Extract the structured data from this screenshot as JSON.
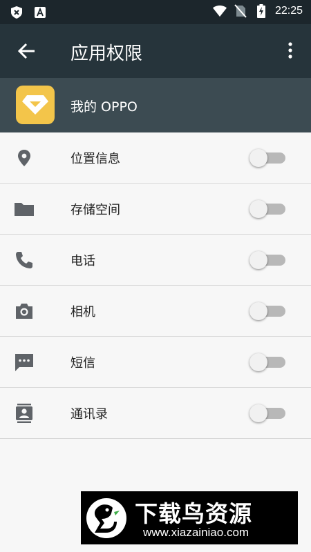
{
  "status_bar": {
    "time": "22:25",
    "left_icons": [
      "shield-x-icon",
      "a-box-icon"
    ],
    "right_icons": [
      "wifi-icon",
      "no-sim-icon",
      "battery-charging-icon"
    ]
  },
  "app_bar": {
    "title": "应用权限",
    "back_icon": "arrow-left-icon",
    "more_icon": "more-vert-icon",
    "background": "#26343b"
  },
  "app_header": {
    "name": "我的 OPPO",
    "icon": "oppo-diamond-icon",
    "icon_color": "#f3c54a",
    "background": "#3c4b52"
  },
  "permissions": [
    {
      "label": "位置信息",
      "icon": "location-pin-icon",
      "enabled": false
    },
    {
      "label": "存储空间",
      "icon": "folder-icon",
      "enabled": false
    },
    {
      "label": "电话",
      "icon": "phone-icon",
      "enabled": false
    },
    {
      "label": "相机",
      "icon": "camera-icon",
      "enabled": false
    },
    {
      "label": "短信",
      "icon": "sms-icon",
      "enabled": false
    },
    {
      "label": "通讯录",
      "icon": "contacts-icon",
      "enabled": false
    }
  ],
  "watermark": {
    "title": "下载鸟资源",
    "url": "www.xiazainiao.com"
  }
}
